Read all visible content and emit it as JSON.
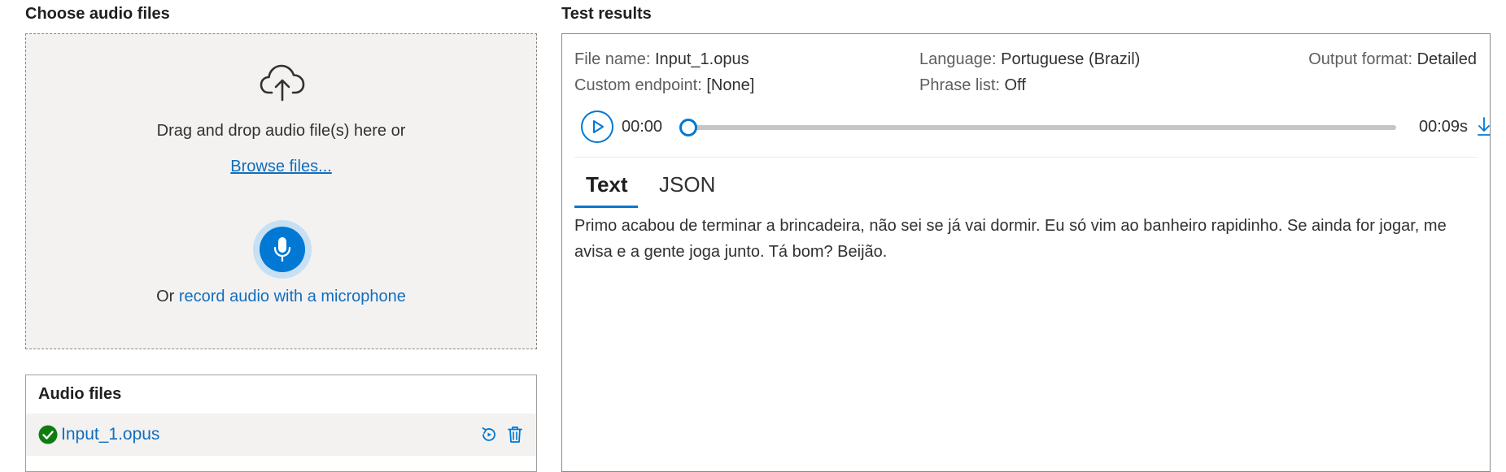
{
  "left": {
    "title": "Choose audio files",
    "dropzone": {
      "drag_text": "Drag and drop audio file(s) here or",
      "browse_label": "Browse files...",
      "record_prefix": "Or ",
      "record_link": "record audio with a microphone"
    },
    "audio_files": {
      "title": "Audio files",
      "items": [
        {
          "name": "Input_1.opus",
          "status": "success"
        }
      ]
    }
  },
  "right": {
    "title": "Test results",
    "meta": {
      "file_name_label": "File name:",
      "file_name": "Input_1.opus",
      "language_label": "Language:",
      "language": "Portuguese (Brazil)",
      "output_format_label": "Output format:",
      "output_format": "Detailed",
      "custom_endpoint_label": "Custom endpoint:",
      "custom_endpoint": "[None]",
      "phrase_list_label": "Phrase list:",
      "phrase_list": "Off"
    },
    "player": {
      "current_time": "00:00",
      "total_time": "00:09s",
      "progress": 0
    },
    "tabs": [
      {
        "label": "Text",
        "selected": true
      },
      {
        "label": "JSON",
        "selected": false
      }
    ],
    "transcript": "Primo acabou de terminar a brincadeira, não sei se já vai dormir. Eu só vim ao banheiro rapidinho. Se ainda for jogar, me avisa e a gente joga junto. Tá bom? Beijão."
  },
  "colors": {
    "accent": "#0078d4",
    "link": "#106ebe",
    "success": "#107c10",
    "panel_bg": "#f3f2f1"
  },
  "icons": {
    "upload": "cloud-upload-icon",
    "mic": "microphone-icon",
    "success": "check-circle-icon",
    "replay": "replay-icon",
    "delete": "trash-icon",
    "play": "play-icon",
    "download": "download-icon"
  }
}
